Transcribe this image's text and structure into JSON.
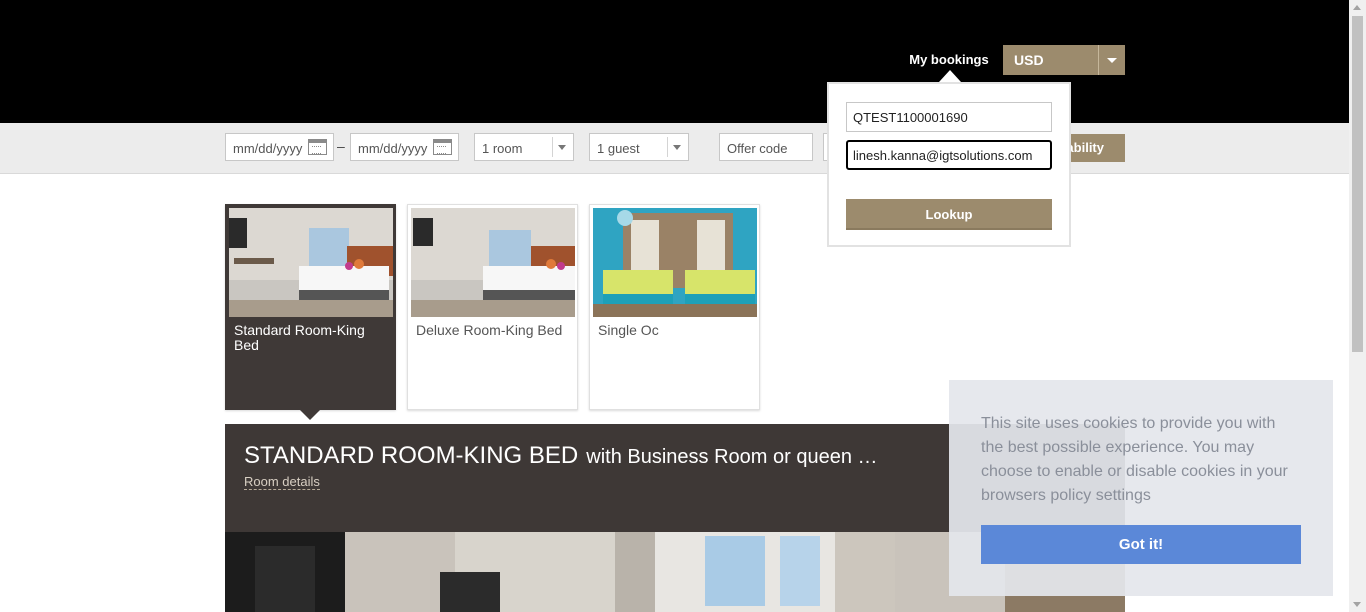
{
  "header": {
    "my_bookings": "My bookings",
    "currency": "USD",
    "caret_icon": "chevron-down-icon"
  },
  "search": {
    "checkin_placeholder": "mm/dd/yyyy",
    "date_separator": "–",
    "checkout_placeholder": "mm/dd/yyyy",
    "rooms": "1 room",
    "guests": "1 guest",
    "offer_placeholder": "Offer code",
    "availability_label": "ability"
  },
  "booking_lookup": {
    "confirmation_value": "QTEST1100001690",
    "email_value": "linesh.kanna@igtsolutions.com",
    "lookup_label": "Lookup"
  },
  "rooms": [
    {
      "name": "Standard Room-King Bed",
      "selected": true
    },
    {
      "name": "Deluxe Room-King Bed",
      "selected": false
    },
    {
      "name": "Single Oc",
      "selected": false
    }
  ],
  "hero": {
    "title": "STANDARD ROOM-KING BED",
    "subtitle": "with Business Room or queen …",
    "details_link": "Room details"
  },
  "cookie_banner": {
    "text": "This site uses cookies to provide you with the best possible experience. You may choose to enable or disable cookies in your browsers policy settings",
    "button": "Got it!"
  },
  "colors": {
    "brand_gold": "#9c8b6d",
    "active_card": "#3f3937",
    "cookie_button": "#5b88d8"
  }
}
